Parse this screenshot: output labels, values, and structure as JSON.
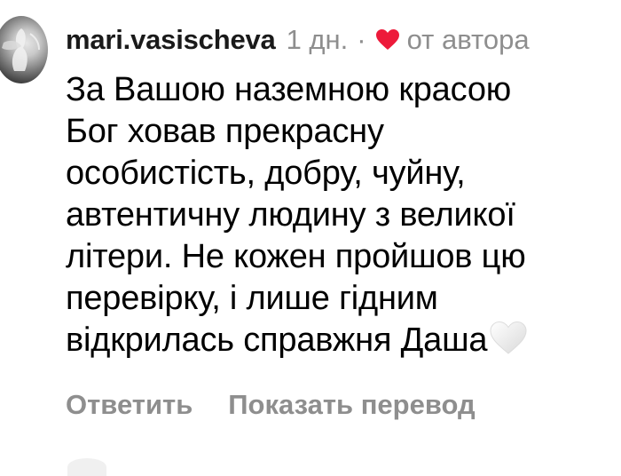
{
  "comment": {
    "avatar_icon": "user-avatar-photo",
    "username": "mari.vasischeva",
    "time": "1 дн.",
    "separator": "·",
    "author_like_icon": "red-heart-icon",
    "author_like_color": "#ed1a3a",
    "author_like_label": "от автора",
    "body_lines": [
      "За Вашою наземною красою",
      "Бог ховав прекрасну",
      "особистість, добру, чуйну,",
      "автентичну людину з великої",
      "літери. Не кожен пройшов цю",
      "перевірку, і лише гідним",
      "відкрилась справжня Даша"
    ],
    "body_emoji": "white-heart-emoji",
    "actions": {
      "reply_label": "Ответить",
      "translate_label": "Показать перевод"
    },
    "next_item_icon": "user-avatar-partial"
  },
  "colors": {
    "text": "#000000",
    "secondary_text": "#8e8e8e",
    "background": "#ffffff"
  }
}
